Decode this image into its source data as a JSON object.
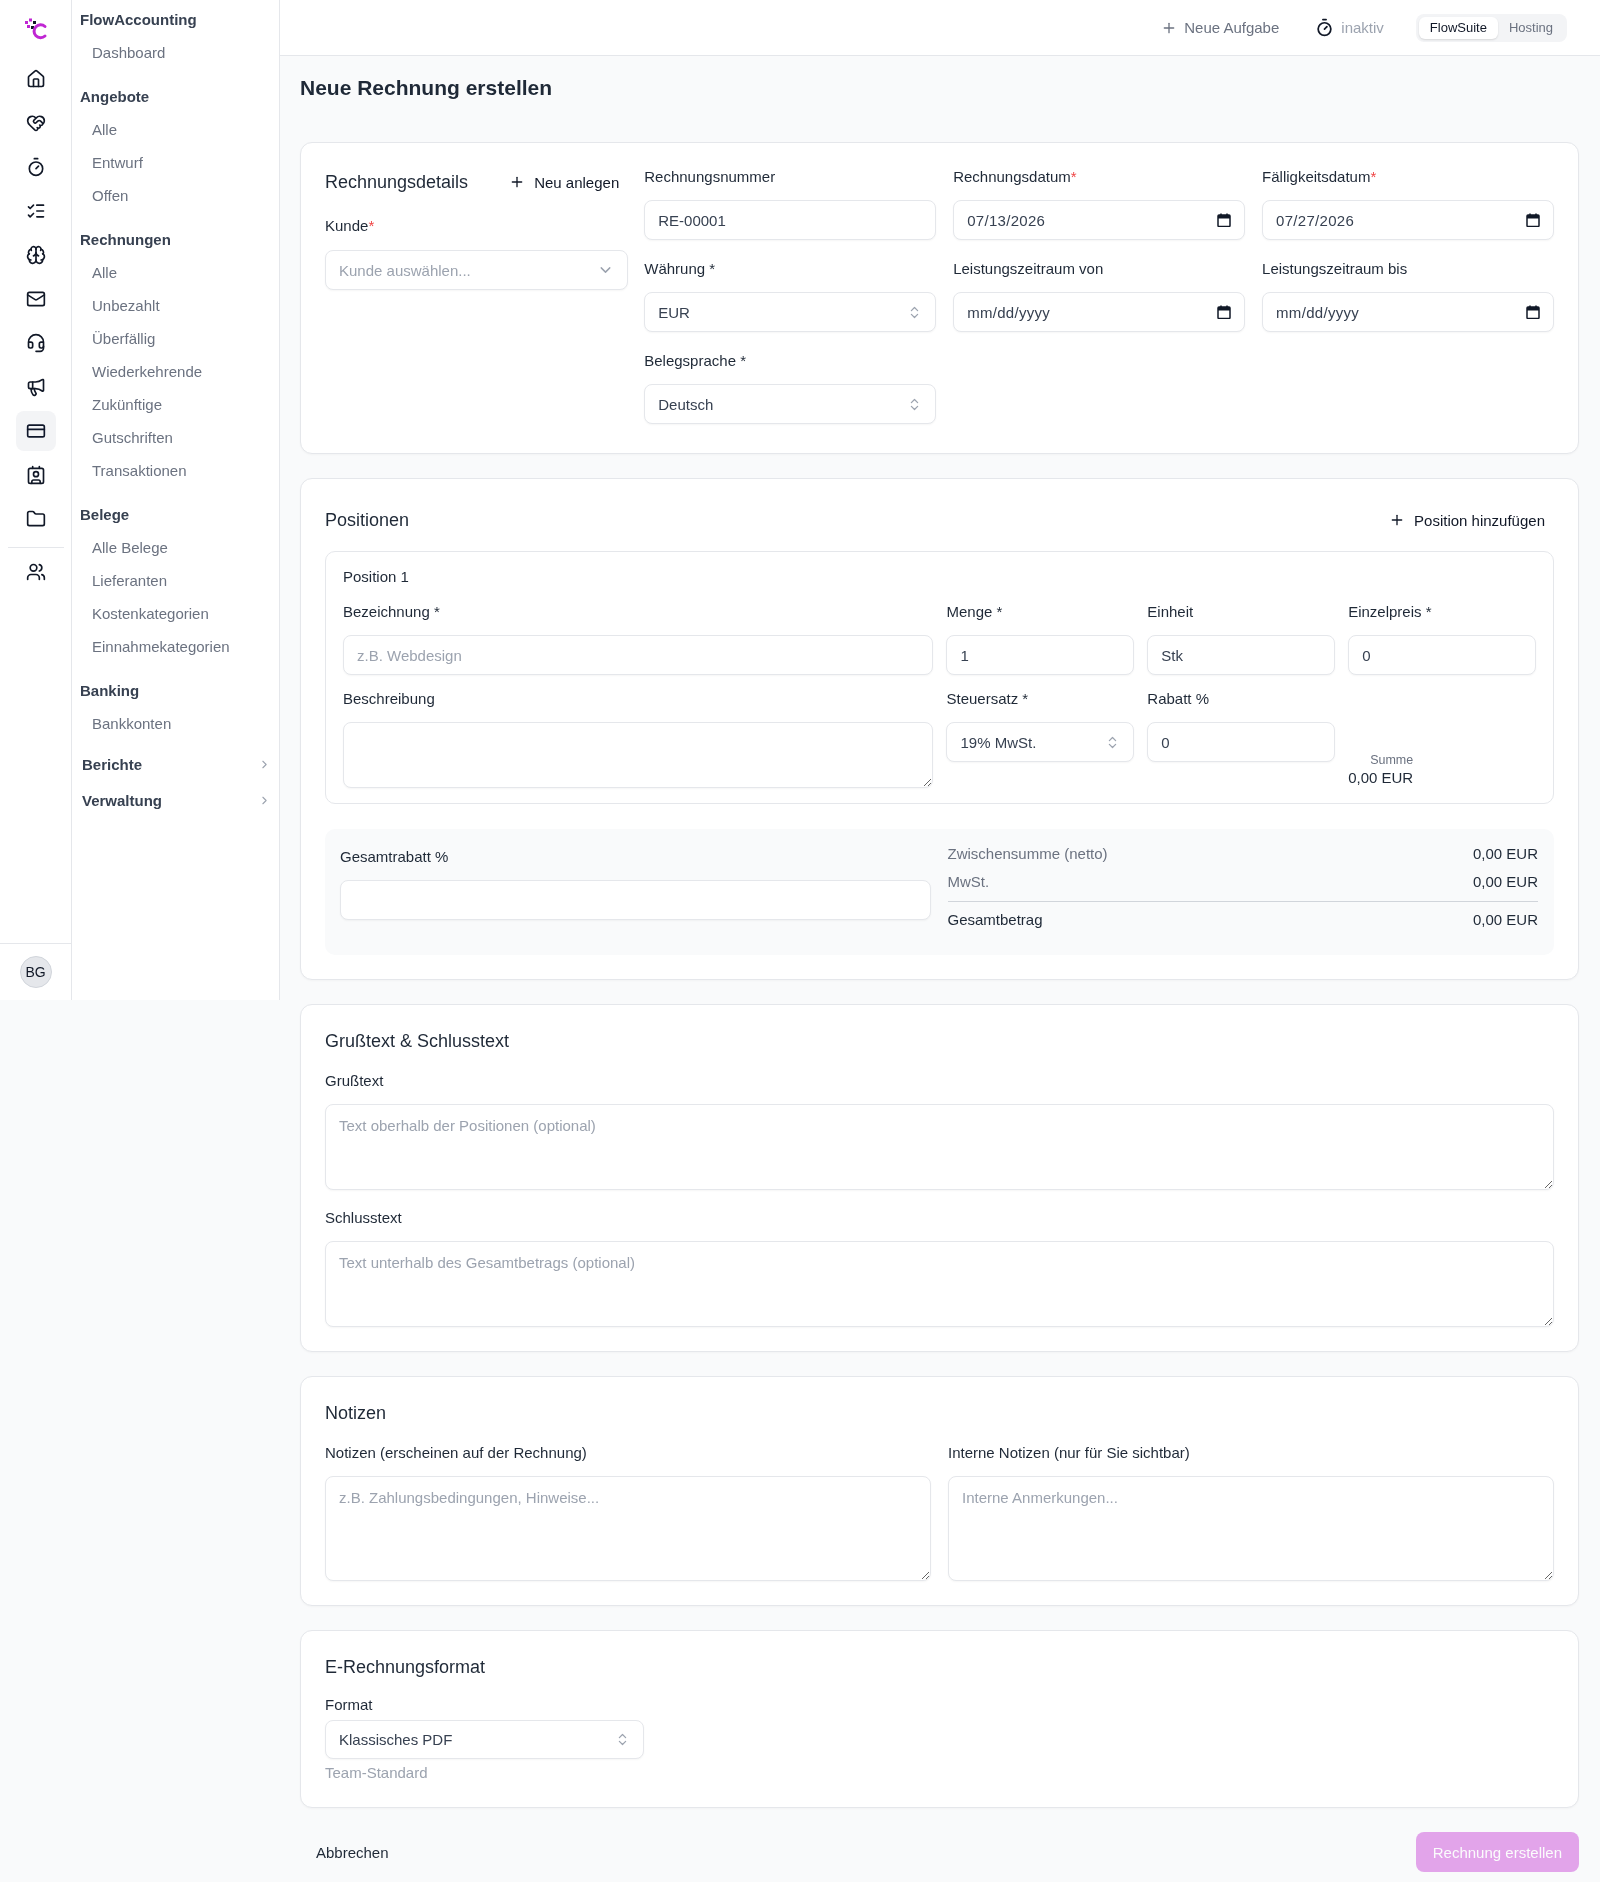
{
  "rail": {
    "main": [
      {
        "selected": false
      },
      {
        "selected": false
      },
      {
        "selected": false
      },
      {
        "selected": false
      },
      {
        "selected": false
      },
      {
        "selected": false
      },
      {
        "selected": false
      },
      {
        "selected": false
      },
      {
        "selected": true
      },
      {
        "selected": false
      },
      {
        "selected": false
      }
    ],
    "secondary": [
      {
        "selected": false
      }
    ],
    "avatar": "BG"
  },
  "sidebar": {
    "sections": [
      {
        "title": "FlowAccounting",
        "items": [
          "Dashboard"
        ]
      },
      {
        "title": "Angebote",
        "items": [
          "Alle",
          "Entwurf",
          "Offen"
        ]
      },
      {
        "title": "Rechnungen",
        "items": [
          "Alle",
          "Unbezahlt",
          "Überfällig",
          "Wiederkehrende",
          "Zukünftige",
          "Gutschriften",
          "Transaktionen"
        ]
      },
      {
        "title": "Belege",
        "items": [
          "Alle Belege",
          "Lieferanten",
          "Kostenkategorien",
          "Einnahmekategorien"
        ]
      },
      {
        "title": "Banking",
        "items": [
          "Bankkonten"
        ]
      }
    ],
    "collapsibles": [
      {
        "title": "Berichte",
        "expanded": false
      },
      {
        "title": "Verwaltung",
        "expanded": false
      }
    ]
  },
  "topbar": {
    "new_task": "Neue Aufgabe",
    "timer_status": "inaktiv",
    "switcher": [
      {
        "label": "FlowSuite",
        "selected": true
      },
      {
        "label": "Hosting",
        "selected": false
      }
    ]
  },
  "page_title": "Neue Rechnung erstellen",
  "details": {
    "title": "Rechnungsdetails",
    "new_button": "Neu anlegen",
    "customer": {
      "kind": "combobox",
      "label": "Kunde",
      "required_mark": "*",
      "placeholder": "Kunde auswählen..."
    },
    "fields": [
      {
        "kind": "text",
        "label": "Rechnungsnummer",
        "value": "RE-00001"
      },
      {
        "kind": "date",
        "label": "Rechnungsdatum",
        "required_mark": "*",
        "value": "07/13/2026"
      },
      {
        "kind": "date",
        "label": "Fälligkeitsdatum",
        "required_mark": "*",
        "value": "07/27/2026"
      },
      {
        "kind": "select",
        "label": "Währung *",
        "value": "EUR"
      },
      {
        "kind": "date",
        "label": "Leistungszeitraum von",
        "placeholder": "mm/dd/yyyy"
      },
      {
        "kind": "date",
        "label": "Leistungszeitraum bis",
        "placeholder": "mm/dd/yyyy"
      },
      {
        "kind": "select",
        "label": "Belegsprache *",
        "value": "Deutsch"
      }
    ]
  },
  "positions": {
    "title": "Positionen",
    "add_button": "Position hinzufügen",
    "items": [
      {
        "title": "Position 1",
        "fields": [
          {
            "kind": "text",
            "label": "Bezeichnung *",
            "placeholder": "z.B. Webdesign"
          },
          {
            "kind": "text",
            "label": "Menge *",
            "value": "1"
          },
          {
            "kind": "text",
            "label": "Einheit",
            "value": "Stk"
          },
          {
            "kind": "text",
            "label": "Einzelpreis *",
            "value": "0"
          },
          {
            "kind": "textarea",
            "label": "Beschreibung"
          },
          {
            "kind": "select",
            "label": "Steuersatz *",
            "value": "19% MwSt."
          },
          {
            "kind": "text",
            "label": "Rabatt %",
            "value": "0"
          },
          {
            "kind": "sum",
            "label": "Summe",
            "value": "0,00 EUR"
          }
        ]
      }
    ],
    "discount": {
      "kind": "text",
      "label": "Gesamtrabatt %"
    },
    "totals": [
      {
        "kind": "subtotal",
        "label": "Zwischensumme (netto)",
        "value": "0,00 EUR"
      },
      {
        "kind": "subtotal",
        "label": "MwSt.",
        "value": "0,00 EUR"
      },
      {
        "kind": "total",
        "label": "Gesamtbetrag",
        "value": "0,00 EUR"
      }
    ]
  },
  "texts": {
    "title": "Grußtext & Schlusstext",
    "fields": [
      {
        "kind": "textarea",
        "label": "Grußtext",
        "placeholder": "Text oberhalb der Positionen (optional)"
      },
      {
        "kind": "textarea",
        "label": "Schlusstext",
        "placeholder": "Text unterhalb des Gesamtbetrags (optional)"
      }
    ]
  },
  "notes": {
    "title": "Notizen",
    "fields": [
      {
        "kind": "textarea",
        "label": "Notizen (erscheinen auf der Rechnung)",
        "placeholder": "z.B. Zahlungsbedingungen, Hinweise..."
      },
      {
        "kind": "textarea",
        "label": "Interne Notizen (nur für Sie sichtbar)",
        "placeholder": "Interne Anmerkungen..."
      }
    ]
  },
  "e_invoice": {
    "title": "E-Rechnungsformat",
    "field": {
      "kind": "select",
      "label": "Format",
      "value": "Klassisches PDF"
    },
    "hint": "Team-Standard"
  },
  "footer": {
    "cancel": "Abbrechen",
    "submit": {
      "label": "Rechnung erstellen",
      "disabled": true
    }
  }
}
